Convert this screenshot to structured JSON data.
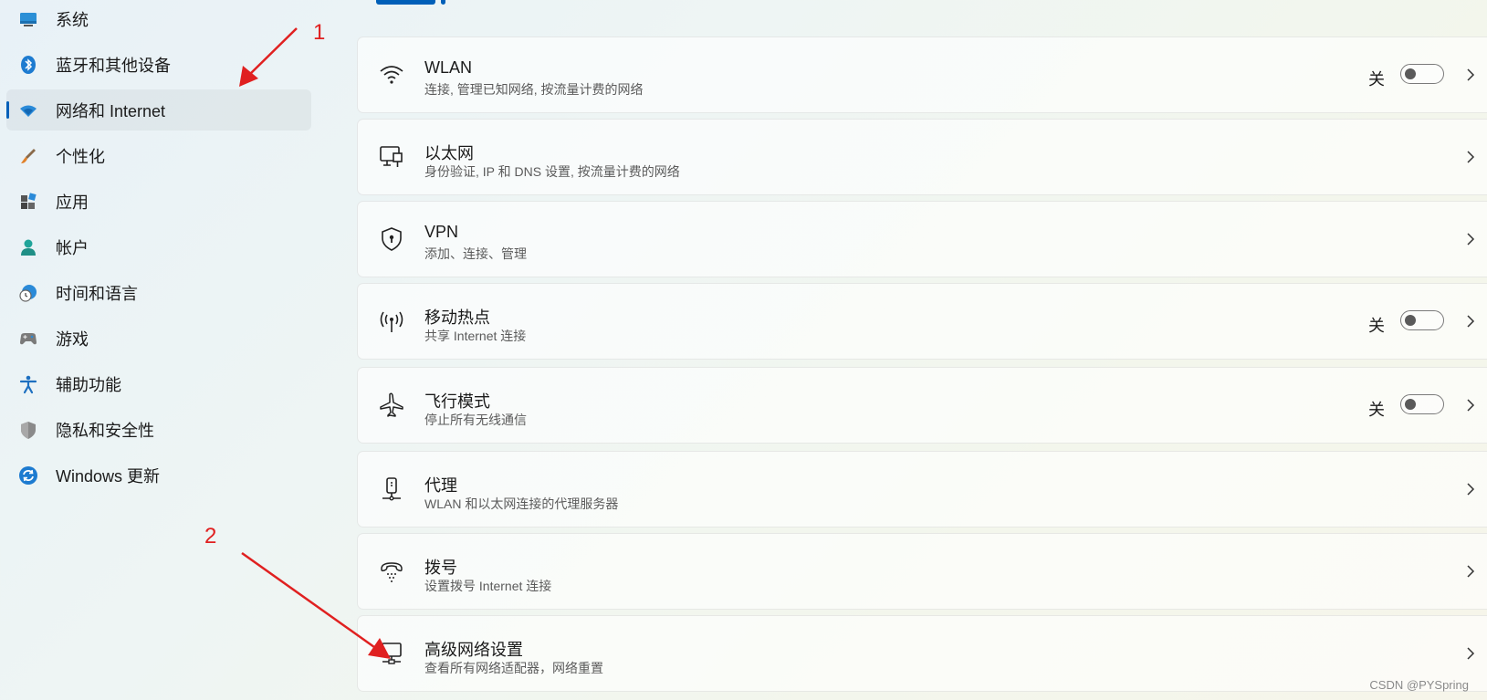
{
  "sidebar": {
    "items": [
      {
        "label": "系统",
        "icon": "monitor-icon"
      },
      {
        "label": "蓝牙和其他设备",
        "icon": "bluetooth-icon"
      },
      {
        "label": "网络和 Internet",
        "icon": "wifi-diamond-icon",
        "selected": true
      },
      {
        "label": "个性化",
        "icon": "brush-icon"
      },
      {
        "label": "应用",
        "icon": "apps-icon"
      },
      {
        "label": "帐户",
        "icon": "person-icon"
      },
      {
        "label": "时间和语言",
        "icon": "globe-clock-icon"
      },
      {
        "label": "游戏",
        "icon": "gamepad-icon"
      },
      {
        "label": "辅助功能",
        "icon": "accessibility-icon"
      },
      {
        "label": "隐私和安全性",
        "icon": "shield-icon"
      },
      {
        "label": "Windows 更新",
        "icon": "sync-icon"
      }
    ]
  },
  "cards": [
    {
      "title": "WLAN",
      "subtitle": "连接, 管理已知网络, 按流量计费的网络",
      "icon": "wifi-icon",
      "toggle": {
        "state_label": "关",
        "on": false
      }
    },
    {
      "title": "以太网",
      "subtitle": "身份验证, IP 和 DNS 设置, 按流量计费的网络",
      "icon": "ethernet-icon"
    },
    {
      "title": "VPN",
      "subtitle": "添加、连接、管理",
      "icon": "vpn-shield-icon"
    },
    {
      "title": "移动热点",
      "subtitle": "共享 Internet 连接",
      "icon": "hotspot-icon",
      "toggle": {
        "state_label": "关",
        "on": false
      }
    },
    {
      "title": "飞行模式",
      "subtitle": "停止所有无线通信",
      "icon": "airplane-icon",
      "toggle": {
        "state_label": "关",
        "on": false
      }
    },
    {
      "title": "代理",
      "subtitle": "WLAN 和以太网连接的代理服务器",
      "icon": "proxy-icon"
    },
    {
      "title": "拨号",
      "subtitle": "设置拨号 Internet 连接",
      "icon": "dialup-icon"
    },
    {
      "title": "高级网络设置",
      "subtitle": "查看所有网络适配器，网络重置",
      "icon": "network-adapter-icon"
    }
  ],
  "annotations": {
    "label_1": "1",
    "label_2": "2",
    "color": "#e02020"
  },
  "watermark": "CSDN @PYSpring",
  "colors": {
    "accent": "#005fb8"
  }
}
